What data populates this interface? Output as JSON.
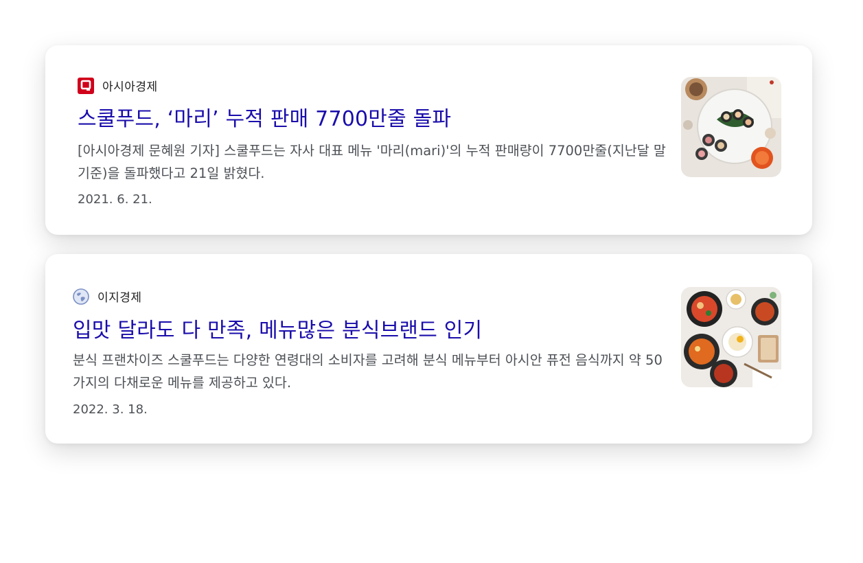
{
  "results": [
    {
      "source": {
        "name": "아시아경제",
        "icon": "asiae-logo-icon",
        "color": "#d0021b"
      },
      "title": "스쿨푸드, ‘마리’ 누적 판매 7700만줄 돌파",
      "snippet": "[아시아경제 문혜원 기자] 스쿨푸드는 자사 대표 메뉴 '마리(mari)'의 누적 판매량이 7700만줄(지난달 말 기준)을 돌파했다고 21일 밝혔다.",
      "date": "2021. 6. 21.",
      "thumbnail": "gimbap-platter-image"
    },
    {
      "source": {
        "name": "이지경제",
        "icon": "globe-icon",
        "color": "#7a8fc4"
      },
      "title": "입맛 달라도 다 만족, 메뉴많은 분식브랜드 인기",
      "snippet": "분식 프랜차이즈 스쿨푸드는 다양한 연령대의 소비자를 고려해 분식 메뉴부터 아시안 퓨전 음식까지 약 50가지의 다채로운 메뉴를 제공하고 있다.",
      "date": "2022. 3. 18.",
      "thumbnail": "bunsik-dishes-image"
    }
  ],
  "colors": {
    "link": "#1a0dab",
    "text": "#4d5156",
    "source_text": "#222222"
  }
}
